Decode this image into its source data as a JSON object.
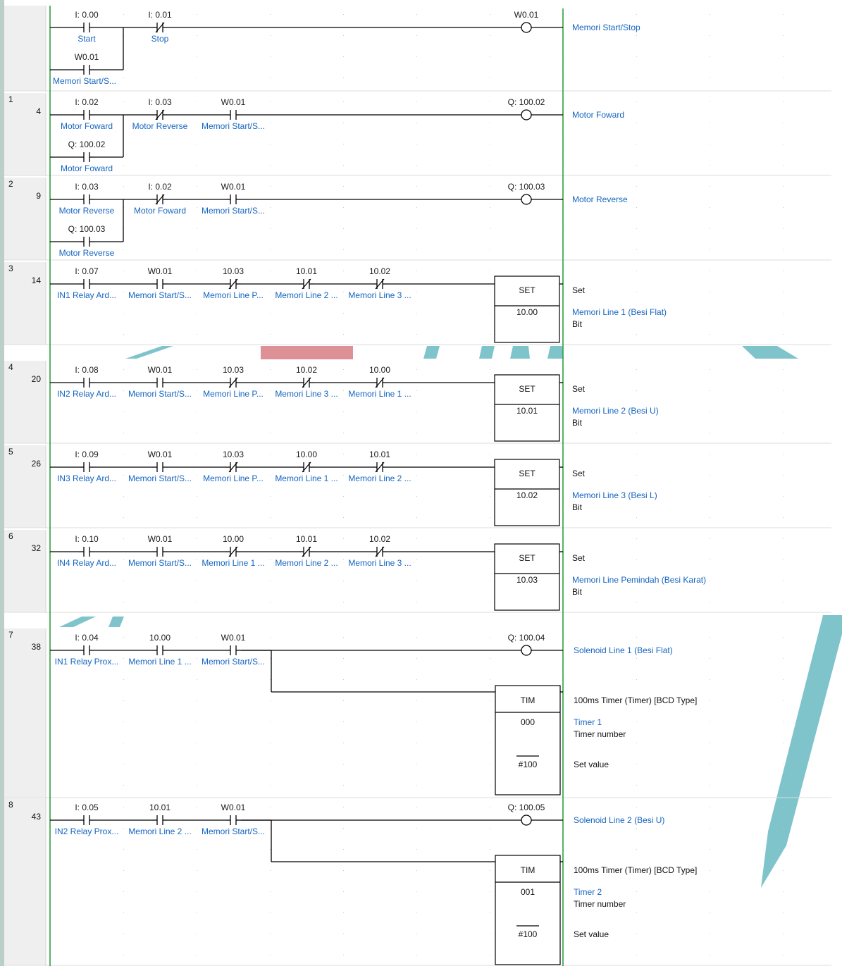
{
  "palette": {
    "gutter": "#efefef",
    "gutter_edge": "#b9cfc8",
    "rail": "#2e9e3e",
    "wire": "#000000",
    "address_text": "#1a1a1a",
    "comment_text": "#1565c0",
    "grid_dot": "#c9c9c9",
    "separator": "#dcdcdc",
    "watermark_teal": "#78c1c8",
    "watermark_red": "#db8a90"
  },
  "rungs": [
    {
      "index": "",
      "step": "",
      "contacts": [
        {
          "addr": "I: 0.00",
          "type": "NO",
          "comment": "Start"
        },
        {
          "addr": "I: 0.01",
          "type": "NC",
          "comment": "Stop"
        }
      ],
      "branch": {
        "addr": "W0.01",
        "type": "NO",
        "comment": "Memori Start/S..."
      },
      "output": {
        "kind": "coil",
        "addr": "W0.01",
        "comment": "Memori Start/Stop"
      }
    },
    {
      "index": "1",
      "step": "4",
      "contacts": [
        {
          "addr": "I: 0.02",
          "type": "NO",
          "comment": "Motor Foward"
        },
        {
          "addr": "I: 0.03",
          "type": "NC",
          "comment": "Motor Reverse"
        },
        {
          "addr": "W0.01",
          "type": "NO",
          "comment": "Memori Start/S..."
        }
      ],
      "branch": {
        "addr": "Q: 100.02",
        "type": "NO",
        "comment": "Motor Foward"
      },
      "output": {
        "kind": "coil",
        "addr": "Q: 100.02",
        "comment": "Motor Foward"
      }
    },
    {
      "index": "2",
      "step": "9",
      "contacts": [
        {
          "addr": "I: 0.03",
          "type": "NO",
          "comment": "Motor Reverse"
        },
        {
          "addr": "I: 0.02",
          "type": "NC",
          "comment": "Motor Foward"
        },
        {
          "addr": "W0.01",
          "type": "NO",
          "comment": "Memori Start/S..."
        }
      ],
      "branch": {
        "addr": "Q: 100.03",
        "type": "NO",
        "comment": "Motor Reverse"
      },
      "output": {
        "kind": "coil",
        "addr": "Q: 100.03",
        "comment": "Motor Reverse"
      }
    },
    {
      "index": "3",
      "step": "14",
      "contacts": [
        {
          "addr": "I: 0.07",
          "type": "NO",
          "comment": "IN1 Relay Ard..."
        },
        {
          "addr": "W0.01",
          "type": "NO",
          "comment": "Memori Start/S..."
        },
        {
          "addr": "10.03",
          "type": "NC",
          "comment": "Memori Line P..."
        },
        {
          "addr": "10.01",
          "type": "NC",
          "comment": "Memori Line 2 ..."
        },
        {
          "addr": "10.02",
          "type": "NC",
          "comment": "Memori Line 3 ..."
        }
      ],
      "output": {
        "kind": "set",
        "label": "SET",
        "operand": "10.00",
        "title": "Set",
        "comment": "Memori Line 1 (Besi Flat)",
        "subtitle": "Bit"
      }
    },
    {
      "index": "4",
      "step": "20",
      "contacts": [
        {
          "addr": "I: 0.08",
          "type": "NO",
          "comment": "IN2 Relay Ard..."
        },
        {
          "addr": "W0.01",
          "type": "NO",
          "comment": "Memori Start/S..."
        },
        {
          "addr": "10.03",
          "type": "NC",
          "comment": "Memori Line P..."
        },
        {
          "addr": "10.02",
          "type": "NC",
          "comment": "Memori Line 3 ..."
        },
        {
          "addr": "10.00",
          "type": "NC",
          "comment": "Memori Line 1 ..."
        }
      ],
      "output": {
        "kind": "set",
        "label": "SET",
        "operand": "10.01",
        "title": "Set",
        "comment": "Memori Line 2 (Besi U)",
        "subtitle": "Bit"
      }
    },
    {
      "index": "5",
      "step": "26",
      "contacts": [
        {
          "addr": "I: 0.09",
          "type": "NO",
          "comment": "IN3 Relay Ard..."
        },
        {
          "addr": "W0.01",
          "type": "NO",
          "comment": "Memori Start/S..."
        },
        {
          "addr": "10.03",
          "type": "NC",
          "comment": "Memori Line P..."
        },
        {
          "addr": "10.00",
          "type": "NC",
          "comment": "Memori Line 1 ..."
        },
        {
          "addr": "10.01",
          "type": "NC",
          "comment": "Memori Line 2 ..."
        }
      ],
      "output": {
        "kind": "set",
        "label": "SET",
        "operand": "10.02",
        "title": "Set",
        "comment": "Memori Line 3 (Besi L)",
        "subtitle": "Bit"
      }
    },
    {
      "index": "6",
      "step": "32",
      "contacts": [
        {
          "addr": "I: 0.10",
          "type": "NO",
          "comment": "IN4 Relay Ard..."
        },
        {
          "addr": "W0.01",
          "type": "NO",
          "comment": "Memori Start/S..."
        },
        {
          "addr": "10.00",
          "type": "NC",
          "comment": "Memori Line 1 ..."
        },
        {
          "addr": "10.01",
          "type": "NC",
          "comment": "Memori Line 2 ..."
        },
        {
          "addr": "10.02",
          "type": "NC",
          "comment": "Memori Line 3 ..."
        }
      ],
      "output": {
        "kind": "set",
        "label": "SET",
        "operand": "10.03",
        "title": "Set",
        "comment": "Memori Line Pemindah (Besi Karat)",
        "subtitle": "Bit"
      }
    },
    {
      "index": "7",
      "step": "38",
      "contacts": [
        {
          "addr": "I: 0.04",
          "type": "NO",
          "comment": "IN1 Relay Prox..."
        },
        {
          "addr": "10.00",
          "type": "NO",
          "comment": "Memori Line 1 ..."
        },
        {
          "addr": "W0.01",
          "type": "NO",
          "comment": "Memori Start/S..."
        }
      ],
      "output": {
        "kind": "coil",
        "addr": "Q: 100.04",
        "comment": "Solenoid Line 1 (Besi Flat)"
      },
      "timer": {
        "label": "TIM",
        "number": "000",
        "setvalue": "#100",
        "title": "100ms Timer (Timer) [BCD Type]",
        "name": "Timer 1",
        "number_label": "Timer number",
        "setvalue_label": "Set value"
      }
    },
    {
      "index": "8",
      "step": "43",
      "contacts": [
        {
          "addr": "I: 0.05",
          "type": "NO",
          "comment": "IN2 Relay Prox..."
        },
        {
          "addr": "10.01",
          "type": "NO",
          "comment": "Memori Line 2 ..."
        },
        {
          "addr": "W0.01",
          "type": "NO",
          "comment": "Memori Start/S..."
        }
      ],
      "output": {
        "kind": "coil",
        "addr": "Q: 100.05",
        "comment": "Solenoid Line 2 (Besi U)"
      },
      "timer": {
        "label": "TIM",
        "number": "001",
        "setvalue": "#100",
        "title": "100ms Timer (Timer) [BCD Type]",
        "name": "Timer 2",
        "number_label": "Timer number",
        "setvalue_label": "Set value"
      }
    }
  ]
}
